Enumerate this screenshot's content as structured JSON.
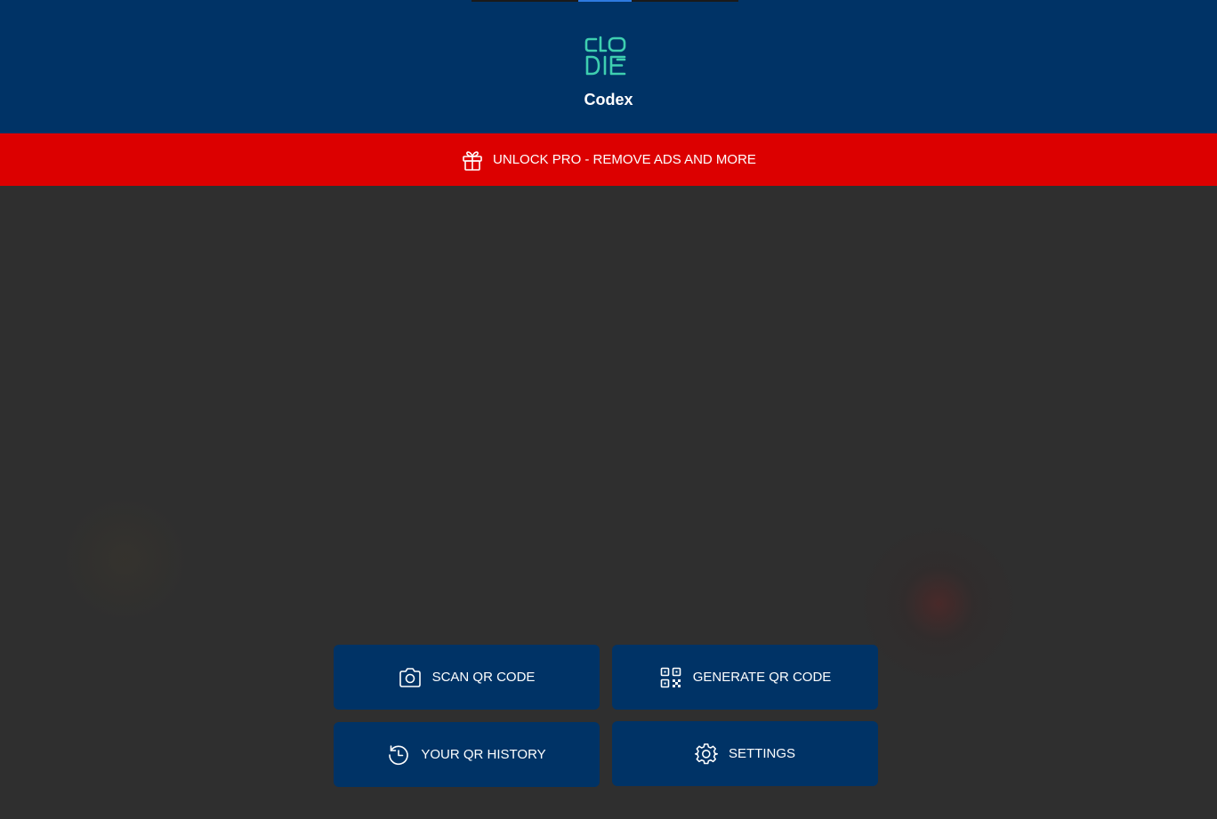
{
  "header": {
    "app_name": "Codex",
    "logo_text": "CLO DIE",
    "logo_icon": "codex-logo-icon",
    "background_color": "#003366",
    "logo_color": "#3ecfb0"
  },
  "promo": {
    "label": "UNLOCK PRO - REMOVE ADS AND MORE",
    "icon": "gift-icon",
    "background_color": "#dc0000"
  },
  "actions": {
    "scan": {
      "label": "SCAN QR CODE",
      "icon": "camera-icon"
    },
    "generate": {
      "label": "GENERATE QR CODE",
      "icon": "qr-code-icon"
    },
    "history": {
      "label": "YOUR QR HISTORY",
      "icon": "history-icon"
    },
    "settings": {
      "label": "SETTINGS",
      "icon": "gear-icon"
    }
  }
}
